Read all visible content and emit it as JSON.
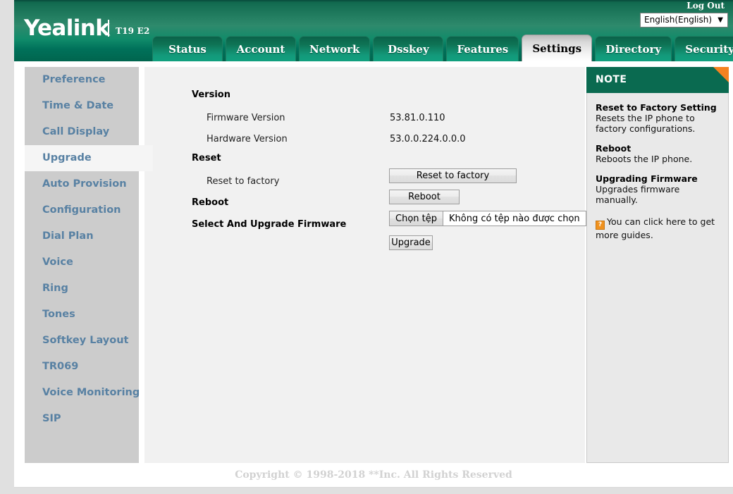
{
  "header": {
    "logo": "Yealink",
    "model": "T19 E2",
    "logout_label": "Log Out",
    "language": {
      "selected": "English(English)",
      "arrow": "▼"
    },
    "brand_green": "#0a6a50",
    "accent_orange": "#f58220"
  },
  "tabs": [
    {
      "label": "Status",
      "active": false
    },
    {
      "label": "Account",
      "active": false
    },
    {
      "label": "Network",
      "active": false
    },
    {
      "label": "Dsskey",
      "active": false
    },
    {
      "label": "Features",
      "active": false
    },
    {
      "label": "Settings",
      "active": true
    },
    {
      "label": "Directory",
      "active": false
    },
    {
      "label": "Security",
      "active": false
    }
  ],
  "sidebar": {
    "items": [
      {
        "label": "Preference",
        "active": false
      },
      {
        "label": "Time & Date",
        "active": false
      },
      {
        "label": "Call Display",
        "active": false
      },
      {
        "label": "Upgrade",
        "active": true
      },
      {
        "label": "Auto Provision",
        "active": false
      },
      {
        "label": "Configuration",
        "active": false
      },
      {
        "label": "Dial Plan",
        "active": false
      },
      {
        "label": "Voice",
        "active": false
      },
      {
        "label": "Ring",
        "active": false
      },
      {
        "label": "Tones",
        "active": false
      },
      {
        "label": "Softkey Layout",
        "active": false
      },
      {
        "label": "TR069",
        "active": false
      },
      {
        "label": "Voice Monitoring",
        "active": false
      },
      {
        "label": "SIP",
        "active": false
      }
    ]
  },
  "main": {
    "version_section_title": "Version",
    "firmware_label": "Firmware Version",
    "firmware_value": "53.81.0.110",
    "hardware_label": "Hardware Version",
    "hardware_value": "53.0.0.224.0.0.0",
    "reset_section_title": "Reset",
    "reset_to_factory_label": "Reset to factory",
    "reset_to_factory_button": "Reset to factory",
    "reboot_label": "Reboot",
    "reboot_button": "Reboot",
    "upgrade_firmware_label": "Select And Upgrade Firmware",
    "file_choose_button": "Chọn tệp",
    "file_name_text": "Không có tệp nào được chọn",
    "upgrade_button": "Upgrade"
  },
  "note": {
    "title": "NOTE",
    "blocks": [
      {
        "heading": "Reset to Factory Setting",
        "text": "Resets the IP phone to factory configurations."
      },
      {
        "heading": "Reboot",
        "text": "Reboots the IP phone."
      },
      {
        "heading": "Upgrading Firmware",
        "text": "Upgrades firmware manually."
      }
    ],
    "guide_icon": "?",
    "guide_text": "You can click here to get more guides."
  },
  "footer": {
    "copyright": "Copyright © 1998-2018 **Inc. All Rights Reserved"
  }
}
